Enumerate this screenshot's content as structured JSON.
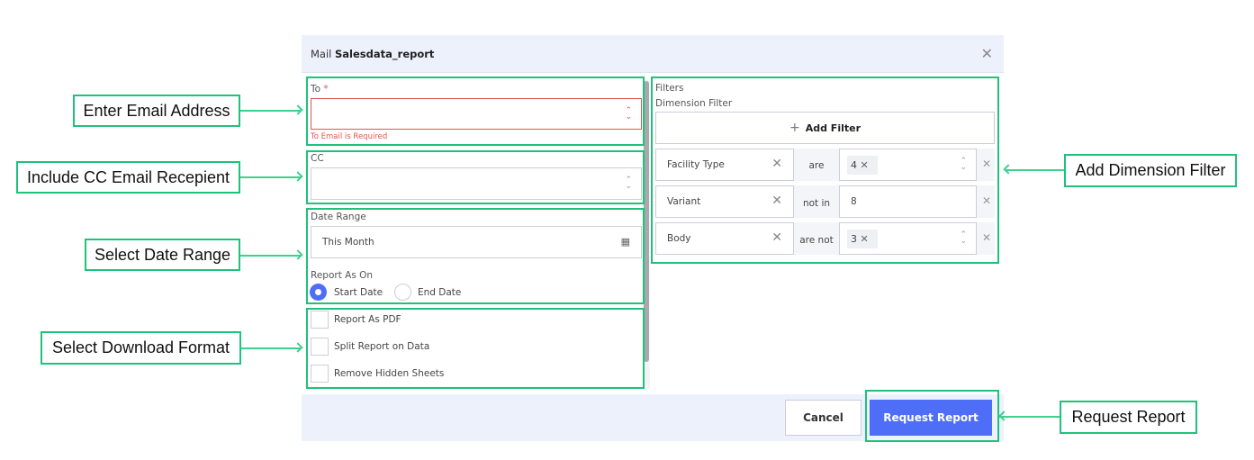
{
  "modal": {
    "title_prefix": "Mail",
    "title_name": "Salesdata_report",
    "close_icon": "close-icon"
  },
  "form": {
    "to": {
      "label": "To",
      "required_mark": "*",
      "value": "",
      "error": "To Email is Required"
    },
    "cc": {
      "label": "CC",
      "value": ""
    },
    "date_range": {
      "label": "Date Range",
      "value": "This Month",
      "icon": "calendar-icon"
    },
    "report_as_on": {
      "label": "Report As On",
      "options": [
        {
          "label": "Start Date",
          "selected": true
        },
        {
          "label": "End Date",
          "selected": false
        }
      ]
    },
    "checkboxes": [
      {
        "label": "Report As PDF",
        "checked": false
      },
      {
        "label": "Split Report on Data",
        "checked": false
      },
      {
        "label": "Remove Hidden Sheets",
        "checked": false
      }
    ]
  },
  "filters": {
    "title": "Filters",
    "subtitle": "Dimension Filter",
    "add_label": "Add Filter",
    "add_icon": "+",
    "rows": [
      {
        "dimension": "Facility Type",
        "operator": "are",
        "value": "4",
        "value_type": "chip"
      },
      {
        "dimension": "Variant",
        "operator": "not in",
        "value": "8",
        "value_type": "text"
      },
      {
        "dimension": "Body",
        "operator": "are not",
        "value": "3",
        "value_type": "chip"
      }
    ]
  },
  "footer": {
    "cancel_label": "Cancel",
    "request_label": "Request Report"
  },
  "callouts": {
    "email": "Enter Email Address",
    "cc": "Include CC Email Recepient",
    "date": "Select Date Range",
    "format": "Select Download Format",
    "filter": "Add Dimension Filter",
    "request": "Request Report"
  },
  "colors": {
    "accent": "#4f6ef7",
    "error": "#e05555",
    "annotation": "#1ec27a",
    "header_bg": "#ecf1fb"
  }
}
